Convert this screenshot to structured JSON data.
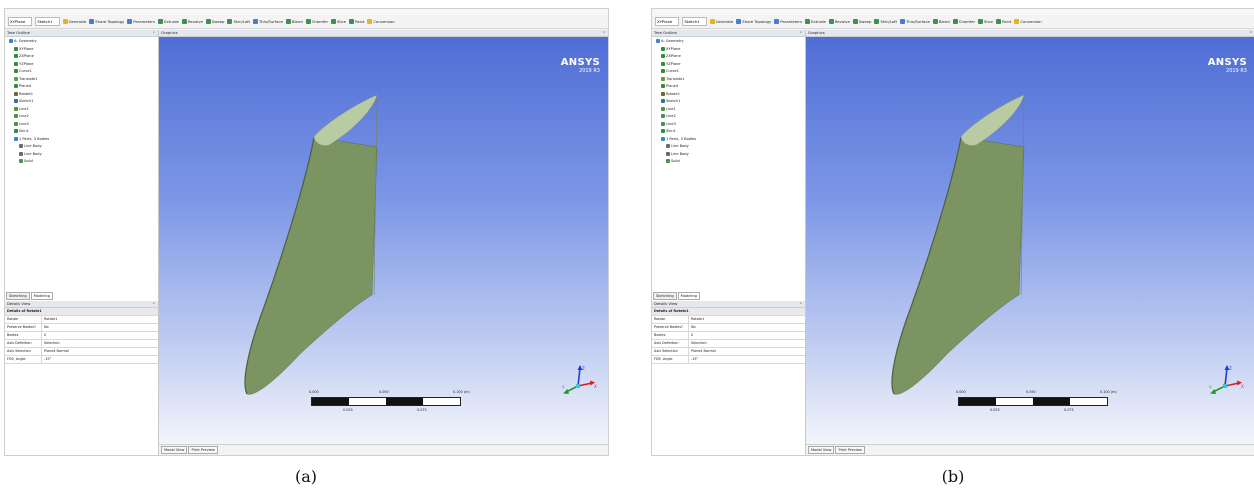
{
  "captions": [
    "(a)",
    "(b)"
  ],
  "window": {
    "toolbar": {
      "plane_select": "XYPlane",
      "sketch_select": "Sketch1",
      "items": [
        "Generate",
        "Share Topology",
        "Parameters",
        "Extrude",
        "Revolve",
        "Sweep",
        "Skin/Loft",
        "Thin/Surface",
        "Blend",
        "Chamfer",
        "Slice",
        "Point",
        "Conversion"
      ]
    },
    "tree_outline": {
      "title": "Tree Outline",
      "items": [
        {
          "label": "A: Geometry",
          "level": 0,
          "icon": "geometry-icon",
          "color": "#3a7fd8"
        },
        {
          "label": "XYPlane",
          "level": 1,
          "icon": "plane-icon",
          "color": "#2f8f3f"
        },
        {
          "label": "ZXPlane",
          "level": 1,
          "icon": "plane-icon",
          "color": "#2f8f3f"
        },
        {
          "label": "YZPlane",
          "level": 1,
          "icon": "plane-icon",
          "color": "#2f8f3f"
        },
        {
          "label": "Curve1",
          "level": 1,
          "icon": "curve-icon",
          "color": "#2f8f3f"
        },
        {
          "label": "Translate1",
          "level": 1,
          "icon": "translate-icon",
          "color": "#6a9a2f"
        },
        {
          "label": "Plane4",
          "level": 1,
          "icon": "plane-icon",
          "color": "#2f8f3f"
        },
        {
          "label": "Rotate1",
          "level": 1,
          "icon": "rotate-icon",
          "color": "#6a6a2f"
        },
        {
          "label": "Sketch1",
          "level": 1,
          "icon": "sketch-icon",
          "color": "#2f6f9f"
        },
        {
          "label": "Line1",
          "level": 1,
          "icon": "line-icon",
          "color": "#4f8f4f"
        },
        {
          "label": "Line2",
          "level": 1,
          "icon": "line-icon",
          "color": "#4f8f4f"
        },
        {
          "label": "Line3",
          "level": 1,
          "icon": "line-icon",
          "color": "#4f8f4f"
        },
        {
          "label": "Skin1",
          "level": 1,
          "icon": "skin-icon",
          "color": "#2f8f3f"
        },
        {
          "label": "1 Parts, 3 Bodies",
          "level": 1,
          "icon": "parts-icon",
          "color": "#3a7fd8"
        },
        {
          "label": "Line Body",
          "level": 2,
          "icon": "line-body-icon",
          "color": "#6a6a6a"
        },
        {
          "label": "Line Body",
          "level": 2,
          "icon": "line-body-icon",
          "color": "#6a6a6a"
        },
        {
          "label": "Solid",
          "level": 2,
          "icon": "solid-icon",
          "color": "#4f8f4f"
        }
      ]
    },
    "panel_tabs": [
      "Sketching",
      "Modeling"
    ],
    "details_view": {
      "title": "Details View",
      "group": "Details of Rotate1",
      "rows": [
        {
          "key": "Rotate",
          "value": "Rotate1"
        },
        {
          "key": "Preserve Bodies?",
          "value": "No"
        },
        {
          "key": "Bodies",
          "value": "0"
        },
        {
          "key": "Axis Definition",
          "value": "Selection"
        },
        {
          "key": "Axis Selection",
          "value": "Plane4 Normal"
        },
        {
          "key": "FD9, Angle",
          "value": "-15°"
        }
      ]
    },
    "graphics": {
      "title": "Graphics",
      "logo": "ANSYS",
      "version": "2019 R3",
      "scale_top": [
        "0.000",
        "0.050",
        "0.100 (m)"
      ],
      "scale_bottom": [
        "0.025",
        "0.075"
      ],
      "triad_labels": [
        "Z",
        "X",
        "Y"
      ]
    },
    "bottom_tabs": [
      "Model View",
      "Print Preview"
    ]
  },
  "colors": {
    "blade_face": "#7b9462",
    "blade_tip": "#b9cba2",
    "triad_x": "#d41f1f",
    "triad_y": "#1f9a2a",
    "triad_z": "#1f3fd4"
  }
}
